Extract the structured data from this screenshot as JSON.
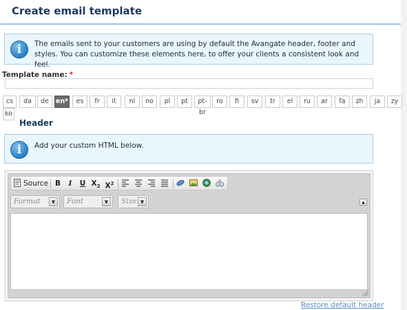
{
  "page": {
    "title": "Create email template"
  },
  "info_box": {
    "icon": "info-icon",
    "text": "The emails sent to your customers are using by default the Avangate header, footer and styles. You can customize these elements here, to offer your clients a consistent look and feel."
  },
  "template_name": {
    "label": "Template name:",
    "required_marker": "*",
    "value": ""
  },
  "languages": {
    "tabs": [
      "cs",
      "da",
      "de",
      "en*",
      "es",
      "fr",
      "it",
      "nl",
      "no",
      "pl",
      "pt",
      "pt-br",
      "ro",
      "fi",
      "sv",
      "tr",
      "el",
      "ru",
      "ar",
      "fa",
      "zh",
      "ja",
      "zy",
      "ko"
    ],
    "active": "en*"
  },
  "header_section": {
    "title": "Header",
    "info_icon": "info-icon",
    "info_text": "Add your custom HTML below."
  },
  "editor": {
    "source_label": "Source",
    "bold_label": "B",
    "italic_label": "I",
    "underline_label": "U",
    "subscript_label": "X",
    "superscript_label": "X",
    "format_placeholder": "Format",
    "font_placeholder": "Font",
    "size_placeholder": "Size",
    "content": ""
  },
  "restore_link": "Restore default header",
  "colors": {
    "title": "#1c3a5e",
    "info_bg": "#eaf6fd",
    "info_border": "#a9cbe2",
    "active_tab": "#6b6b6b",
    "link": "#5c8fc7",
    "required": "#dd2222"
  }
}
